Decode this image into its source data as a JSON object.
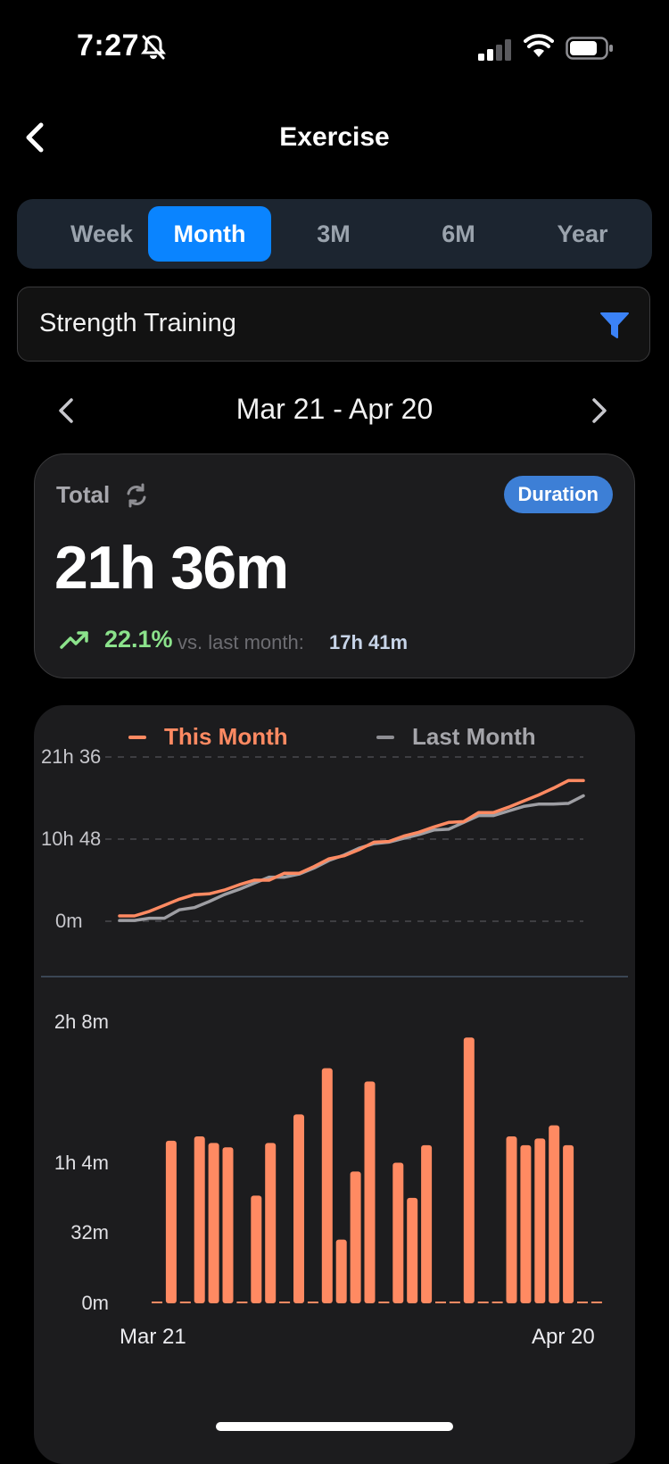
{
  "status_bar": {
    "time": "7:27"
  },
  "nav": {
    "title": "Exercise"
  },
  "segments": [
    "Week",
    "Month",
    "3M",
    "6M",
    "Year"
  ],
  "active_segment": "Month",
  "filter": {
    "value": "Strength Training"
  },
  "date_range": "Mar 21 - Apr 20",
  "summary": {
    "label": "Total",
    "badge": "Duration",
    "total": "21h 36m",
    "change_pct": "22.1%",
    "comparison_label": "vs. last month:",
    "comparison_value": "17h 41m"
  },
  "colors": {
    "accent": "#0a84ff",
    "this_month": "#ff8a62",
    "last_month": "#9e9ea3",
    "positive": "#8be28b"
  },
  "chart_data": [
    {
      "type": "line",
      "series": [
        {
          "name": "This Month",
          "values": [
            0.7,
            0.7,
            1.3,
            2.1,
            2.9,
            3.5,
            3.6,
            4.1,
            4.8,
            5.4,
            5.4,
            6.3,
            6.3,
            7.2,
            8.2,
            8.6,
            9.4,
            10.4,
            10.5,
            11.2,
            11.7,
            12.4,
            13.0,
            13.1,
            14.3,
            14.3,
            15.0,
            15.8,
            16.6,
            17.5,
            18.5,
            18.5
          ]
        },
        {
          "name": "Last Month",
          "values": [
            0.1,
            0.1,
            0.4,
            0.4,
            1.5,
            1.8,
            2.6,
            3.5,
            4.2,
            5.0,
            5.8,
            5.8,
            6.2,
            7.0,
            8.0,
            8.7,
            9.6,
            10.2,
            10.4,
            10.9,
            11.4,
            12.0,
            12.1,
            13.0,
            13.9,
            13.9,
            14.5,
            15.1,
            15.4,
            15.4,
            15.5,
            16.5
          ]
        }
      ],
      "y_ticks": [
        "0m",
        "10h 48",
        "21h 36"
      ],
      "ylim": [
        0,
        21.6
      ],
      "grid": true,
      "legend": "top"
    },
    {
      "type": "bar",
      "x_labels": [
        "Mar 21",
        "Apr 20"
      ],
      "values_minutes": [
        0,
        74,
        0,
        76,
        73,
        71,
        0,
        49,
        73,
        0,
        86,
        0,
        107,
        29,
        60,
        101,
        0,
        64,
        48,
        72,
        0,
        0,
        121,
        0,
        0,
        76,
        72,
        75,
        81,
        72,
        0,
        0
      ],
      "y_ticks": [
        "0m",
        "32m",
        "1h 4m",
        "2h 8m"
      ],
      "ylim": [
        0,
        128
      ]
    }
  ]
}
